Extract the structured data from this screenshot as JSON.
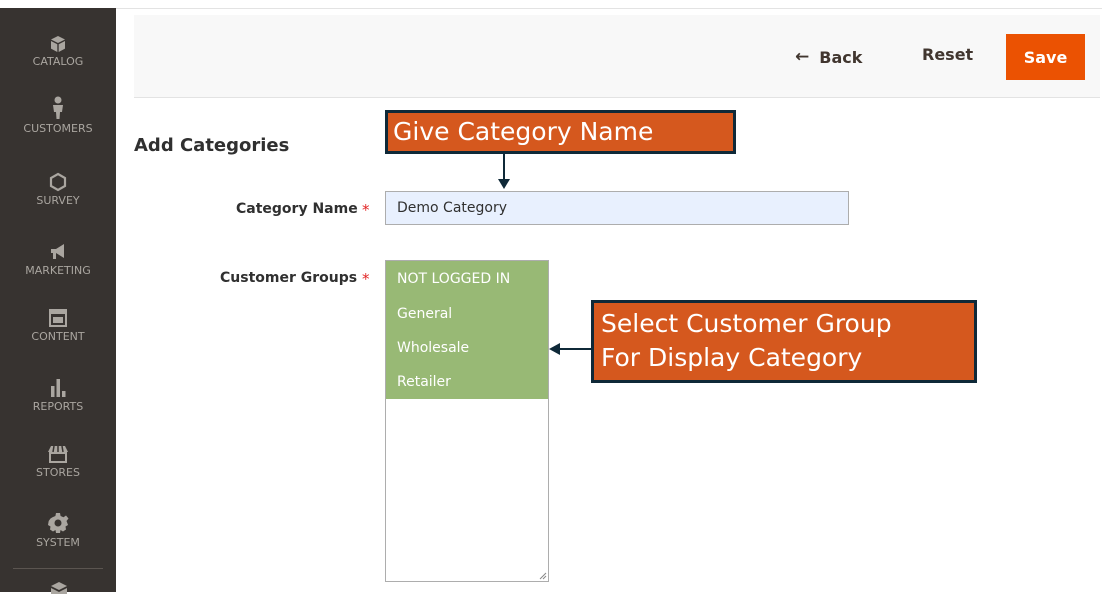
{
  "sidebar": {
    "items": [
      {
        "label": "CATALOG",
        "icon": "catalog-icon"
      },
      {
        "label": "CUSTOMERS",
        "icon": "customers-icon"
      },
      {
        "label": "SURVEY",
        "icon": "survey-icon"
      },
      {
        "label": "MARKETING",
        "icon": "marketing-icon"
      },
      {
        "label": "CONTENT",
        "icon": "content-icon"
      },
      {
        "label": "REPORTS",
        "icon": "reports-icon"
      },
      {
        "label": "STORES",
        "icon": "stores-icon"
      },
      {
        "label": "SYSTEM",
        "icon": "system-icon"
      }
    ]
  },
  "actions": {
    "back": "Back",
    "reset": "Reset",
    "save": "Save"
  },
  "form": {
    "title": "Add Categories",
    "category_name_label": "Category Name",
    "category_name_value": "Demo Category",
    "customer_groups_label": "Customer Groups",
    "required_mark": "*",
    "customer_groups_options": [
      "NOT LOGGED IN",
      "General",
      "Wholesale",
      "Retailer"
    ]
  },
  "annotations": {
    "category_name": "Give Category Name",
    "customer_group_line1": "Select Customer Group",
    "customer_group_line2": "For Display Category"
  },
  "colors": {
    "sidebar_bg": "#373330",
    "save_button": "#eb5202",
    "selected_option": "#98b975",
    "callout_bg": "#d5581e",
    "callout_border": "#0f2938"
  }
}
